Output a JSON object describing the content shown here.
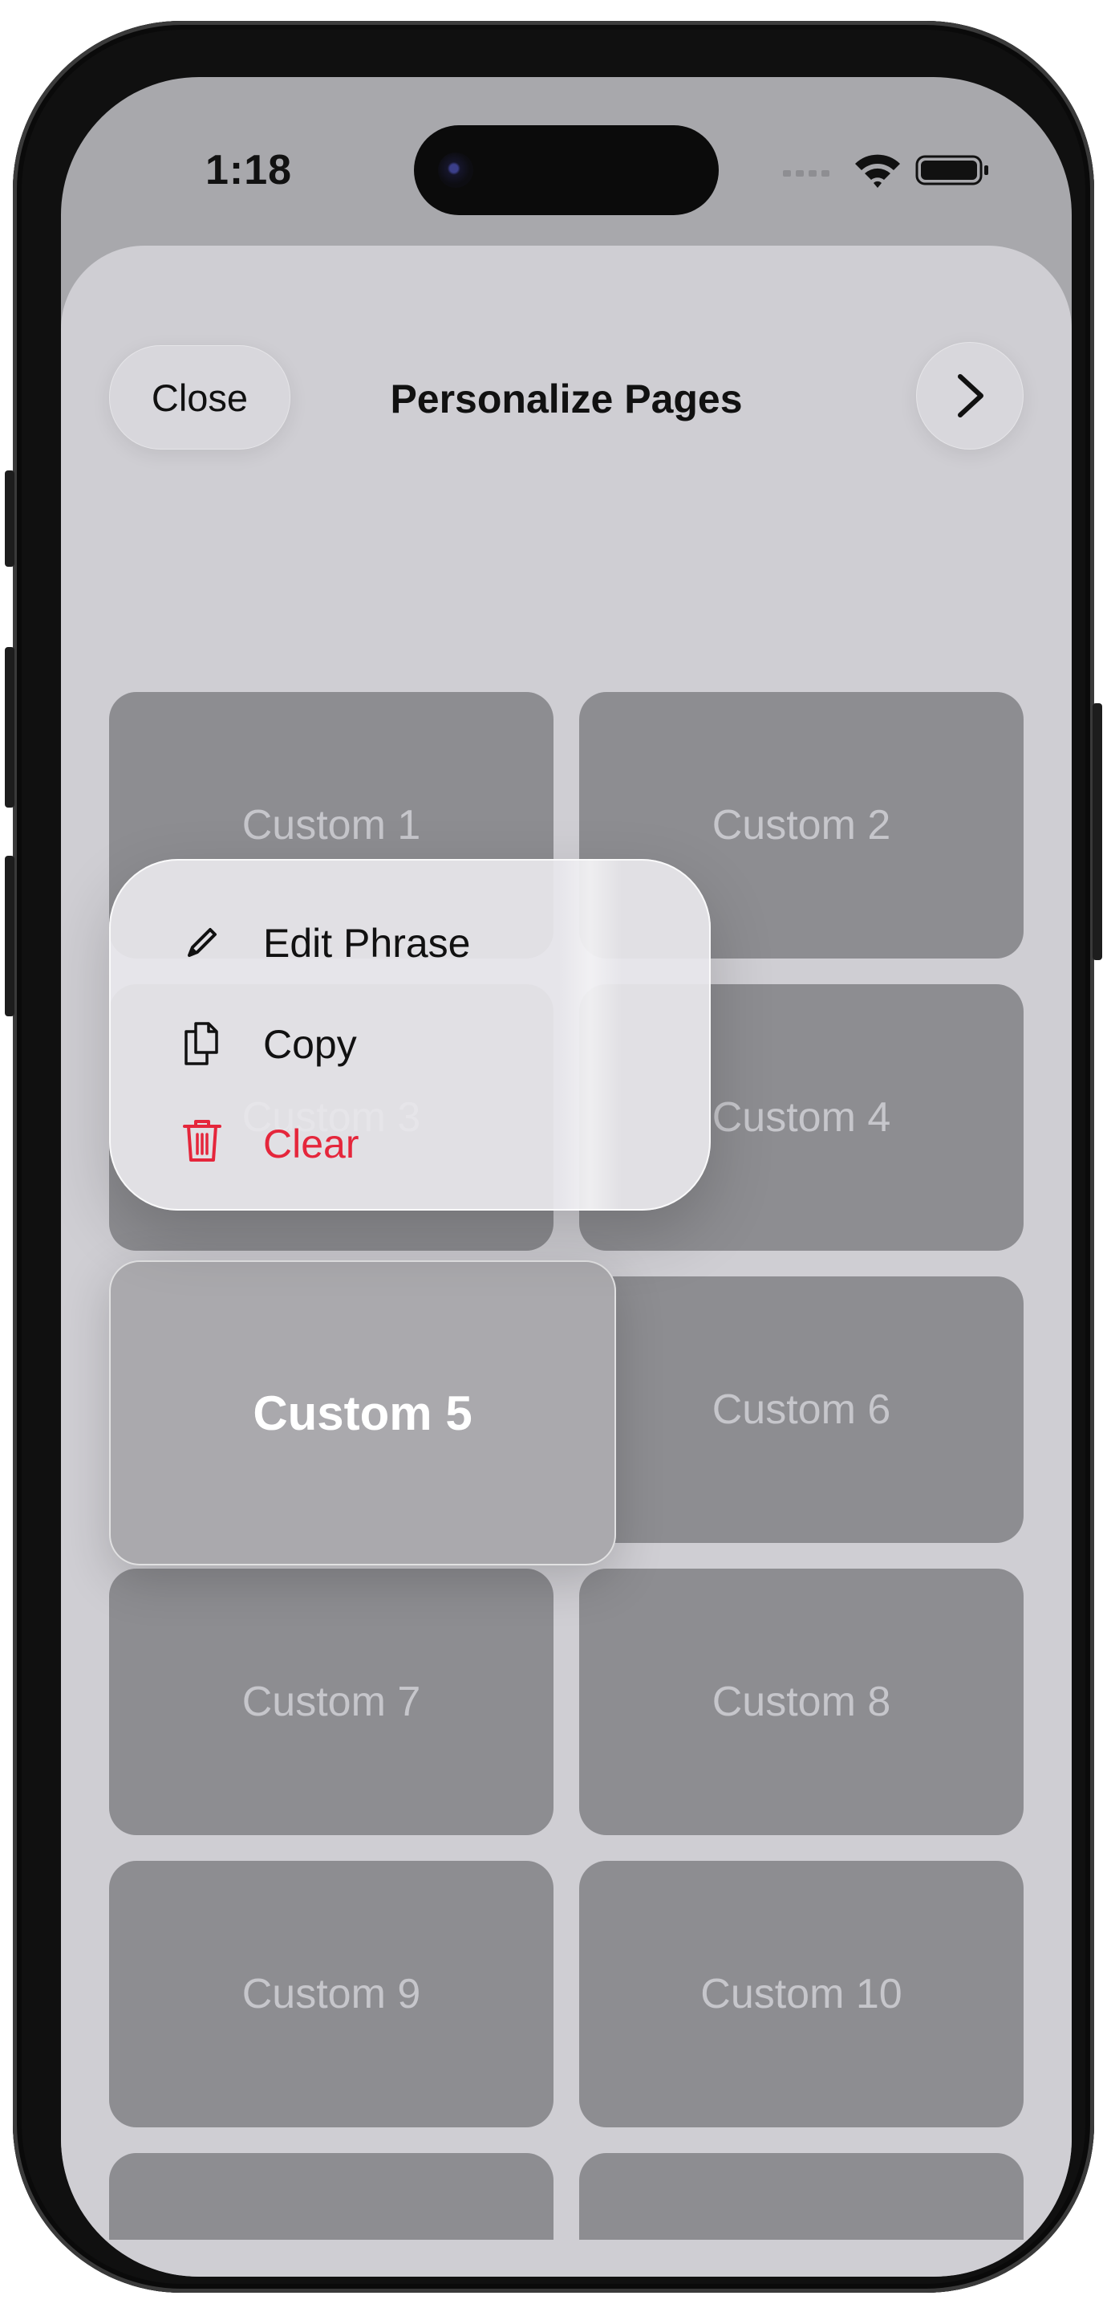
{
  "status_bar": {
    "time": "1:18"
  },
  "header": {
    "close_label": "Close",
    "title": "Personalize Pages"
  },
  "tiles": [
    "Custom 1",
    "Custom 2",
    "Custom 3",
    "Custom 4",
    "Custom 5",
    "Custom 6",
    "Custom 7",
    "Custom 8",
    "Custom 9",
    "Custom 10",
    "",
    ""
  ],
  "selected_tile": "Custom 5",
  "context_menu": {
    "items": [
      {
        "label": "Edit Phrase",
        "icon": "pencil-icon",
        "color": "#111111"
      },
      {
        "label": "Copy",
        "icon": "copy-icon",
        "color": "#111111"
      },
      {
        "label": "Clear",
        "icon": "trash-icon",
        "color": "#e5263b"
      }
    ]
  }
}
